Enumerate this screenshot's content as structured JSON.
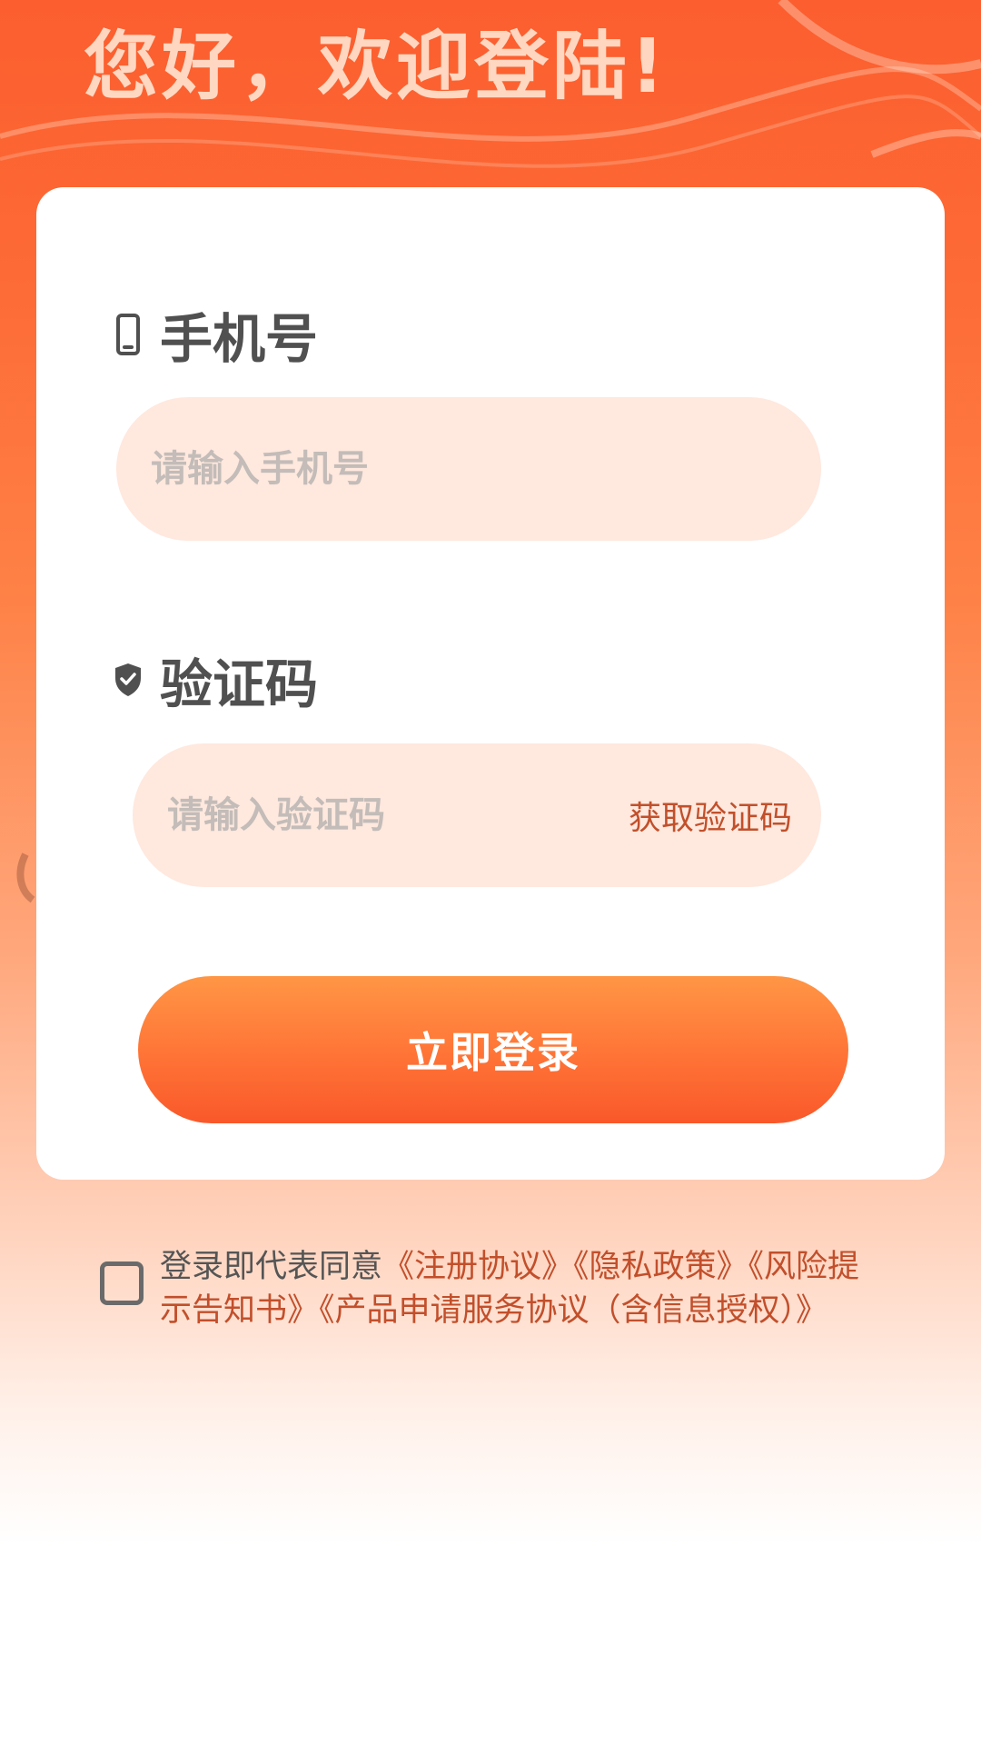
{
  "header": {
    "title": "您好，欢迎登陆!"
  },
  "form": {
    "phone": {
      "label": "手机号",
      "icon": "mobile-phone-icon",
      "placeholder": "请输入手机号"
    },
    "code": {
      "label": "验证码",
      "icon": "shield-check-icon",
      "placeholder": "请输入验证码",
      "get_code_label": "获取验证码"
    },
    "login_button": "立即登录"
  },
  "agreement": {
    "prefix": "登录即代表同意",
    "links": [
      "《注册协议》",
      "《隐私政策》",
      "《风险提示告知书》",
      "《产品申请服务协议（含信息授权）》"
    ]
  },
  "colors": {
    "brand_orange": "#fd6a35",
    "link": "#c24f2b",
    "input_bg": "#ffe8de"
  }
}
